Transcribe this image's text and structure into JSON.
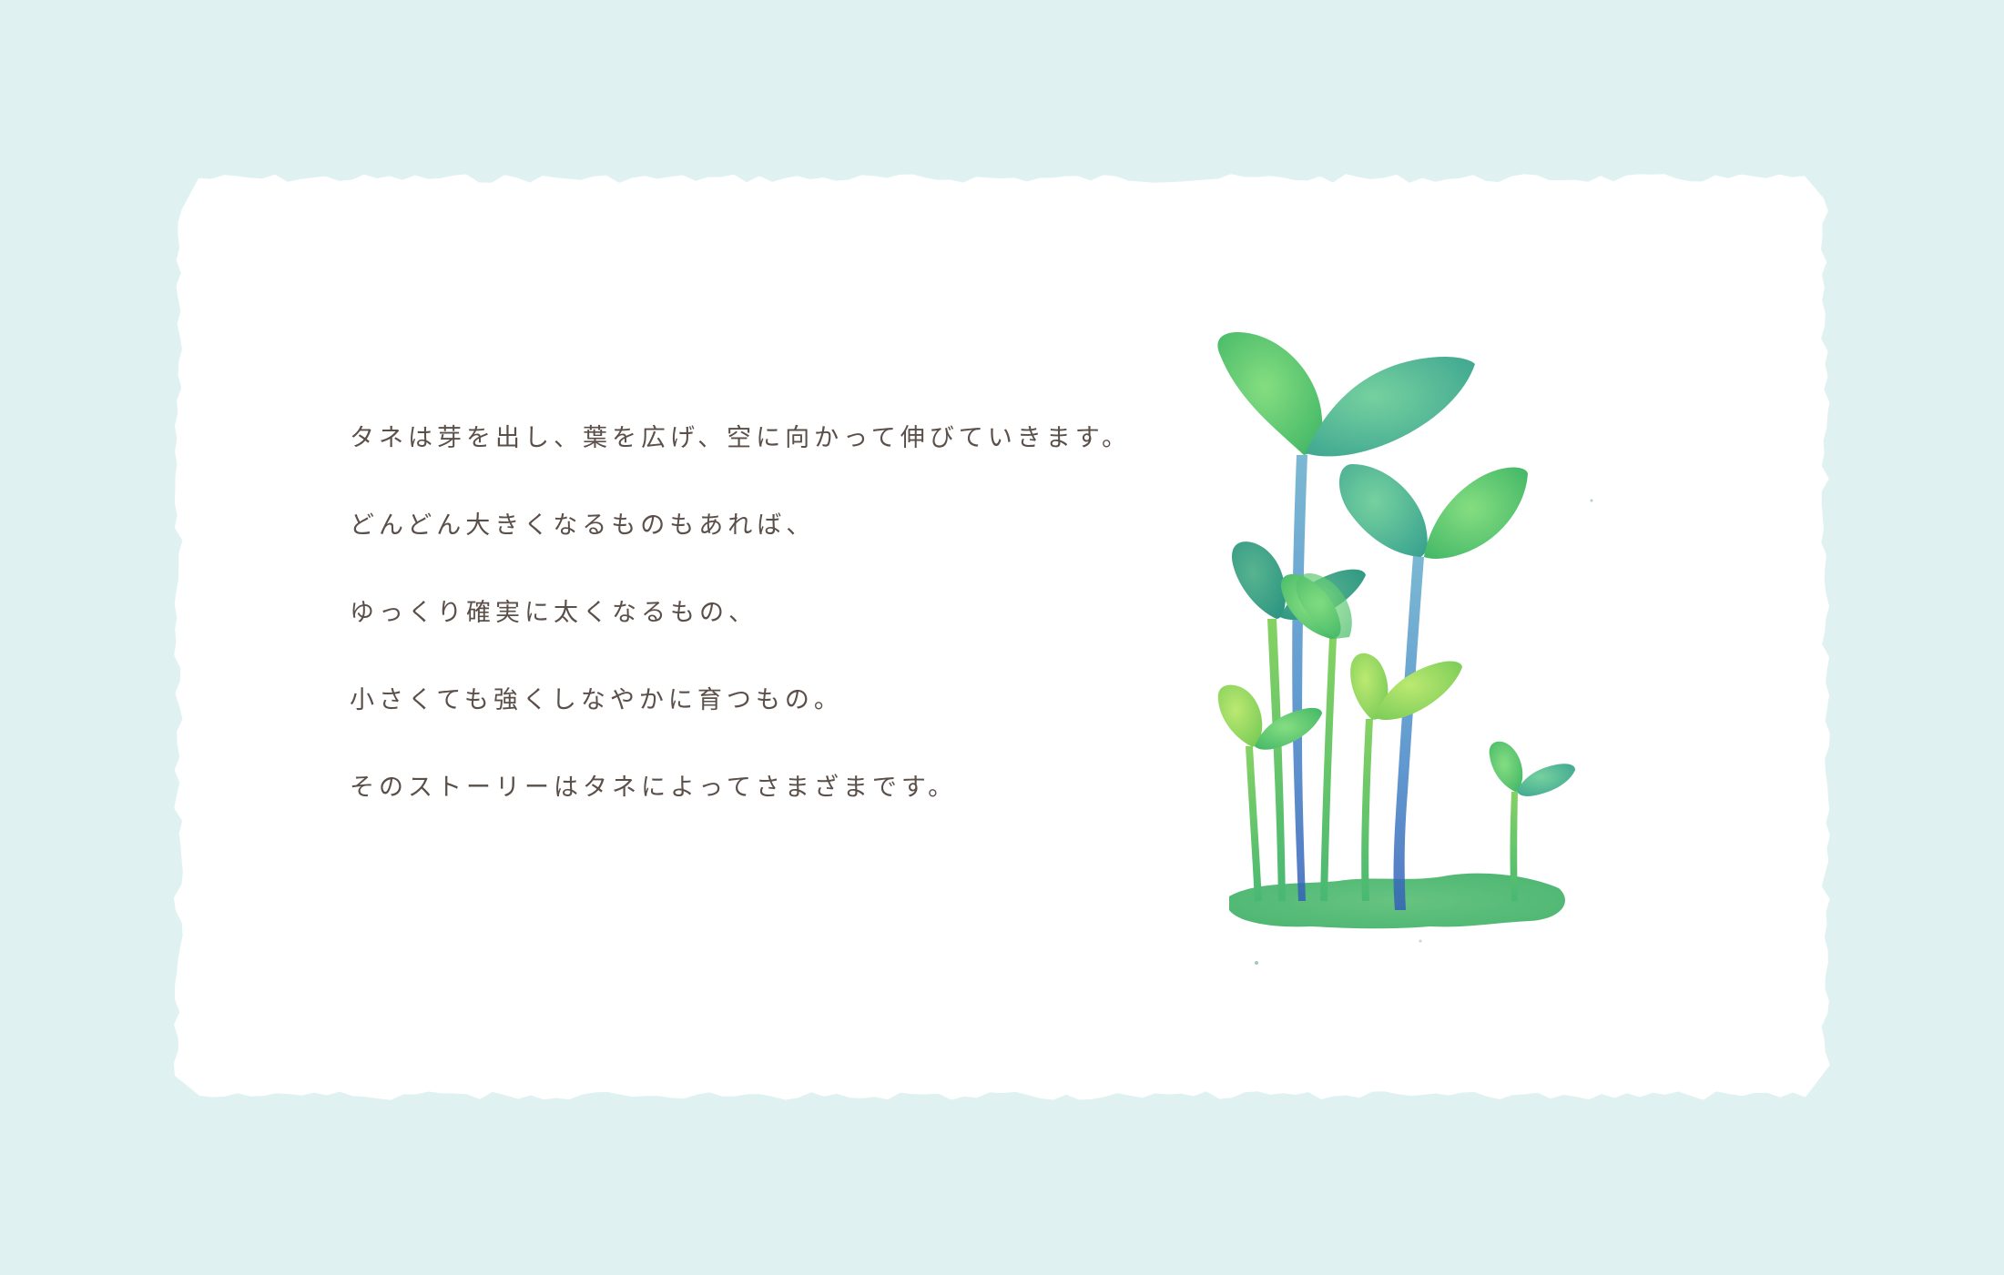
{
  "colors": {
    "background": "#dff1f1",
    "paper": "#ffffff",
    "text": "#5b4f49",
    "leaf_light": "#8fd24c",
    "leaf_mid": "#35b56a",
    "leaf_teal": "#2f9c96",
    "stem_blue": "#2e63b8",
    "ground": "#3fb56c"
  },
  "story": {
    "lines": [
      "タネは芽を出し、葉を広げ、空に向かって伸びていきます。",
      "どんどん大きくなるものもあれば、",
      "ゆっくり確実に太くなるもの、",
      "小さくても強くしなやかに育つもの。",
      "そのストーリーはタネによってさまざまです。"
    ]
  },
  "illustration": {
    "subject": "watercolor-sprouts"
  }
}
